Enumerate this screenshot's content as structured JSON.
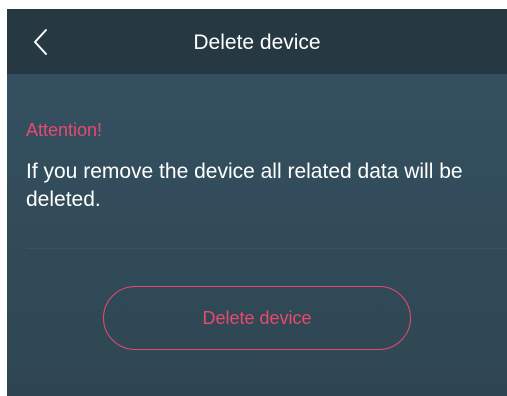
{
  "header": {
    "title": "Delete device",
    "back_icon": "chevron-left-icon"
  },
  "main": {
    "attention_label": "Attention!",
    "message": "If you remove the device all related data will be deleted.",
    "delete_button_label": "Delete device"
  },
  "colors": {
    "header_bg": "#263841",
    "content_bg": "#2f4550",
    "accent": "#e84a6e",
    "text": "#ffffff"
  }
}
